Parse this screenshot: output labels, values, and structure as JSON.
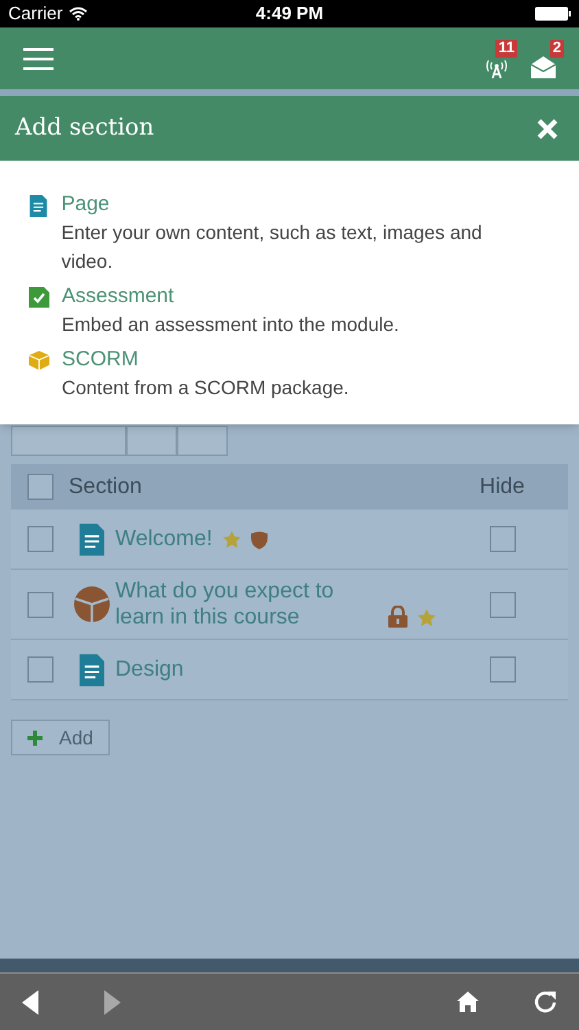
{
  "status_bar": {
    "carrier": "Carrier",
    "time": "4:49 PM"
  },
  "header": {
    "notifications": [
      {
        "kind": "antenna",
        "count": "11"
      },
      {
        "kind": "mail",
        "count": "2"
      }
    ]
  },
  "dialog": {
    "title": "Add section",
    "options": [
      {
        "kind": "page",
        "title": "Page",
        "description": "Enter your own content, such as text, images and video."
      },
      {
        "kind": "assessment",
        "title": "Assessment",
        "description": "Embed an assessment into the module."
      },
      {
        "kind": "scorm",
        "title": "SCORM",
        "description": "Content from a SCORM package."
      }
    ]
  },
  "table": {
    "columns": [
      "Section",
      "Hide"
    ],
    "all_checked": false,
    "rows": [
      {
        "kind": "page",
        "title": "Welcome!",
        "checked": false,
        "hidden": false,
        "markers": [
          {
            "kind": "star"
          },
          {
            "kind": "shield"
          }
        ]
      },
      {
        "kind": "pie",
        "title": "What do you expect to learn in this course",
        "checked": false,
        "hidden": false,
        "markers": [
          {
            "kind": "lock"
          },
          {
            "kind": "star"
          }
        ]
      },
      {
        "kind": "page",
        "title": "Design",
        "checked": false,
        "hidden": false,
        "markers": []
      }
    ]
  },
  "add_button": "Add",
  "nav": {
    "back_disabled": false,
    "forward_disabled": true
  }
}
